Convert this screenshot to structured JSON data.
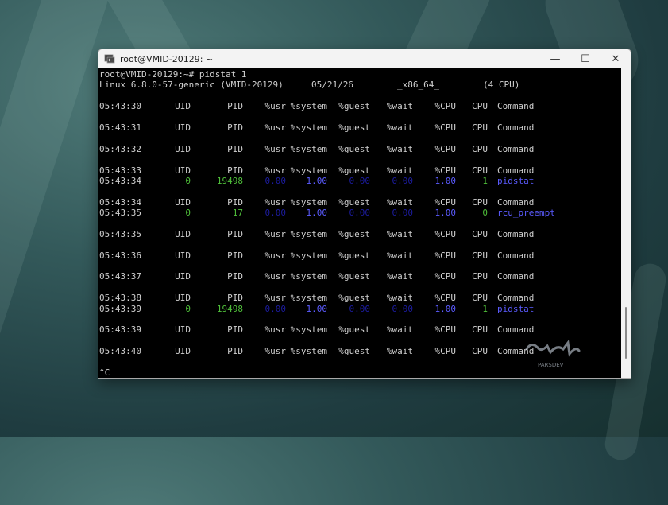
{
  "window": {
    "title": "root@VMID-20129: ~",
    "minimize_glyph": "—",
    "maximize_glyph": "☐",
    "close_glyph": "✕",
    "icon": "terminal-icon"
  },
  "terminal": {
    "prompt_line": "root@VMID-20129:~# pidstat 1",
    "sysinfo": {
      "kernel": "Linux 6.8.0-57-generic (VMID-20129)",
      "date": "05/21/26",
      "arch": "_x86_64_",
      "cpus": "(4 CPU)"
    },
    "header": {
      "uid": "UID",
      "pid": "PID",
      "usr": "%usr",
      "system": "%system",
      "guest": "%guest",
      "wait": "%wait",
      "cpu_pct": "%CPU",
      "cpu": "CPU",
      "command": "Command"
    },
    "blocks": [
      {
        "time": "05:43:30",
        "rows": []
      },
      {
        "time": "05:43:31",
        "rows": []
      },
      {
        "time": "05:43:32",
        "rows": []
      },
      {
        "time": "05:43:33",
        "rows": [
          {
            "time": "05:43:34",
            "uid": "0",
            "pid": "19498",
            "usr": "0.00",
            "system": "1.00",
            "guest": "0.00",
            "wait": "0.00",
            "cpu_pct": "1.00",
            "cpu": "1",
            "command": "pidstat"
          }
        ]
      },
      {
        "time": "05:43:34",
        "rows": [
          {
            "time": "05:43:35",
            "uid": "0",
            "pid": "17",
            "usr": "0.00",
            "system": "1.00",
            "guest": "0.00",
            "wait": "0.00",
            "cpu_pct": "1.00",
            "cpu": "0",
            "command": "rcu_preempt"
          }
        ]
      },
      {
        "time": "05:43:35",
        "rows": []
      },
      {
        "time": "05:43:36",
        "rows": []
      },
      {
        "time": "05:43:37",
        "rows": []
      },
      {
        "time": "05:43:38",
        "rows": [
          {
            "time": "05:43:39",
            "uid": "0",
            "pid": "19498",
            "usr": "0.00",
            "system": "1.00",
            "guest": "0.00",
            "wait": "0.00",
            "cpu_pct": "1.00",
            "cpu": "1",
            "command": "pidstat"
          }
        ]
      },
      {
        "time": "05:43:39",
        "rows": []
      },
      {
        "time": "05:43:40",
        "rows": []
      }
    ],
    "interrupt": "^C"
  },
  "watermark": {
    "text": "PARSDEV"
  },
  "colors": {
    "green": "#4fbf3a",
    "blue": "#5b5bff",
    "dim_blue": "#1c1ca0"
  }
}
